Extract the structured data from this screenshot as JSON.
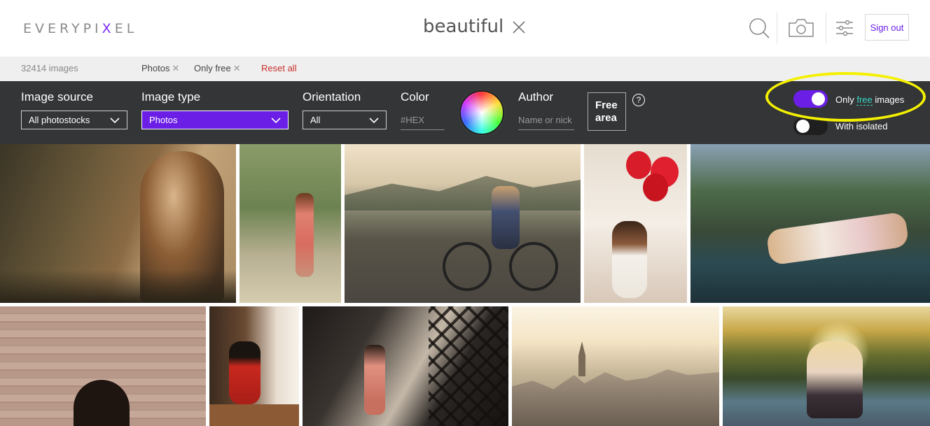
{
  "header": {
    "logo_text_a": "EVERYPI",
    "logo_text_x": "X",
    "logo_text_b": "EL",
    "search_query": "beautiful",
    "sign_out_label": "Sign out",
    "icons": [
      "search-icon",
      "camera-icon",
      "sliders-icon",
      "close-icon"
    ]
  },
  "filter_summary": {
    "count": "32414 images",
    "chips": [
      {
        "label": "Photos",
        "remove": "✕"
      },
      {
        "label": "Only free",
        "remove": "✕"
      }
    ],
    "reset_label": "Reset all"
  },
  "filters": {
    "image_source": {
      "label": "Image source",
      "value": "All photostocks"
    },
    "image_type": {
      "label": "Image type",
      "value": "Photos"
    },
    "orientation": {
      "label": "Orientation",
      "value": "All"
    },
    "color": {
      "label": "Color",
      "placeholder": "#HEX"
    },
    "author": {
      "label": "Author",
      "placeholder": "Name or nick"
    },
    "free_area": {
      "line1": "Free",
      "line2": "area",
      "help": "?"
    },
    "only_free": {
      "prefix": "Only ",
      "free_word": "free",
      "suffix": " images",
      "on": true
    },
    "with_isolated": {
      "label": "With isolated",
      "on": false
    }
  },
  "colors": {
    "accent": "#6a1ee6",
    "panel_bg": "#333536",
    "reset_red": "#c8312b",
    "free_teal": "#38d6c3",
    "highlight_yellow": "#f4f000"
  },
  "photos": [
    {
      "name": "photo-woman-balcony-bokeh"
    },
    {
      "name": "photo-woman-pink-dress-path"
    },
    {
      "name": "photo-girl-on-bicycle"
    },
    {
      "name": "photo-woman-red-balloons"
    },
    {
      "name": "photo-woman-on-car-hood"
    },
    {
      "name": "photo-woman-brick-wall"
    },
    {
      "name": "photo-woman-red-top-cafe"
    },
    {
      "name": "photo-woman-window-shadow"
    },
    {
      "name": "photo-city-rooftops-sunset"
    },
    {
      "name": "photo-woman-sunset-lake"
    }
  ]
}
